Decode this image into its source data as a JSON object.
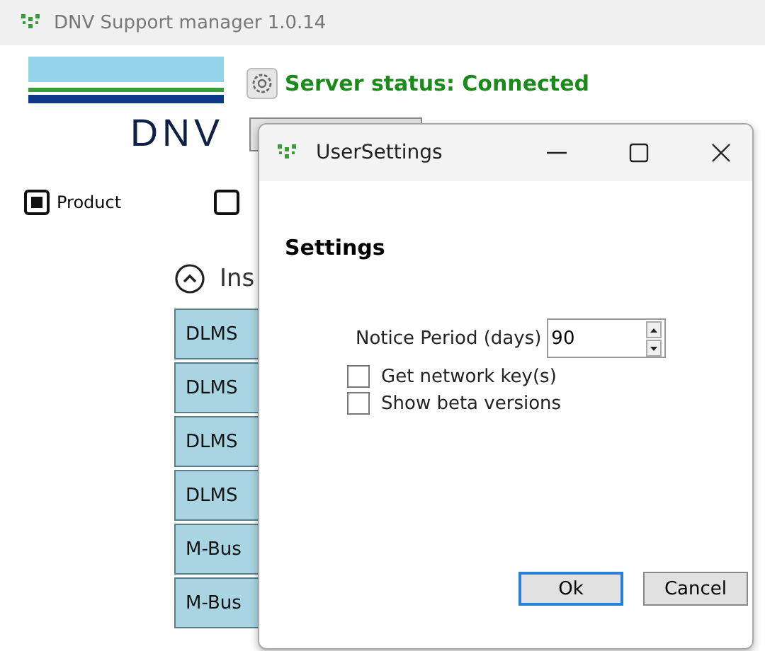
{
  "window": {
    "title": "DNV Support manager 1.0.14"
  },
  "logo": {
    "text": "DNV"
  },
  "server_status": {
    "text": "Server status: Connected"
  },
  "filters": [
    {
      "label": "Product",
      "checked": true
    },
    {
      "checked": false
    }
  ],
  "section": {
    "title": "Ins",
    "expanded": true
  },
  "items": [
    "DLMS",
    "DLMS",
    "DLMS",
    "DLMS",
    "M-Bus",
    "M-Bus"
  ],
  "dialog": {
    "title": "UserSettings",
    "heading": "Settings",
    "notice_period": {
      "label": "Notice Period (days)",
      "value": "90"
    },
    "options": [
      {
        "label": "Get network key(s)",
        "checked": false
      },
      {
        "label": "Show beta versions",
        "checked": false
      }
    ],
    "buttons": [
      {
        "label": "Ok",
        "default": true
      },
      {
        "label": "Cancel",
        "default": false
      }
    ]
  }
}
